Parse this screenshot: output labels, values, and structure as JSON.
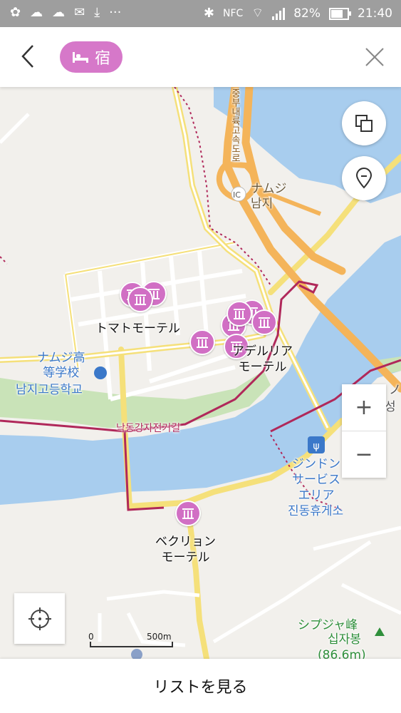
{
  "status_bar": {
    "dots": "···",
    "nfc": "NFC",
    "battery": "82%",
    "time": "21:40"
  },
  "header": {
    "filter_chip": "宿",
    "back_icon": "chevron-left-icon",
    "close_icon": "close-icon",
    "chip_icon": "bed-icon"
  },
  "map": {
    "places": [
      {
        "name": "トマトモーテル"
      },
      {
        "name": "アデルリア\nモーテル"
      },
      {
        "name": "ベクリョン\nモーテル"
      }
    ],
    "labels": {
      "interchange_ja": "ナムジ",
      "interchange_ko": "남지",
      "ic_badge": "IC",
      "school_ja": "ナムジ高\n等学校",
      "school_ko": "남지고등학교",
      "bike_road": "낙동강자전거길",
      "service_ja": "ジンドン\nサービス\nエリア",
      "service_ko": "진동휴게소",
      "peak_ja": "シプジャ峰",
      "peak_ko": "십자봉",
      "peak_height": "(86.6m)",
      "highway": "중부내륙고속도로",
      "right_edge_1": "ノ",
      "right_edge_2": "성"
    },
    "scale": {
      "start": "0",
      "end": "500m"
    },
    "zoom_in": "+",
    "zoom_out": "−"
  },
  "footer": {
    "list_button": "リストを見る"
  },
  "colors": {
    "accent": "#d16fc4",
    "water": "#a8cdee",
    "park": "#c9e3b8",
    "highway": "#f4b45a",
    "road": "#f5e07a",
    "bike_route": "#b0285a"
  }
}
